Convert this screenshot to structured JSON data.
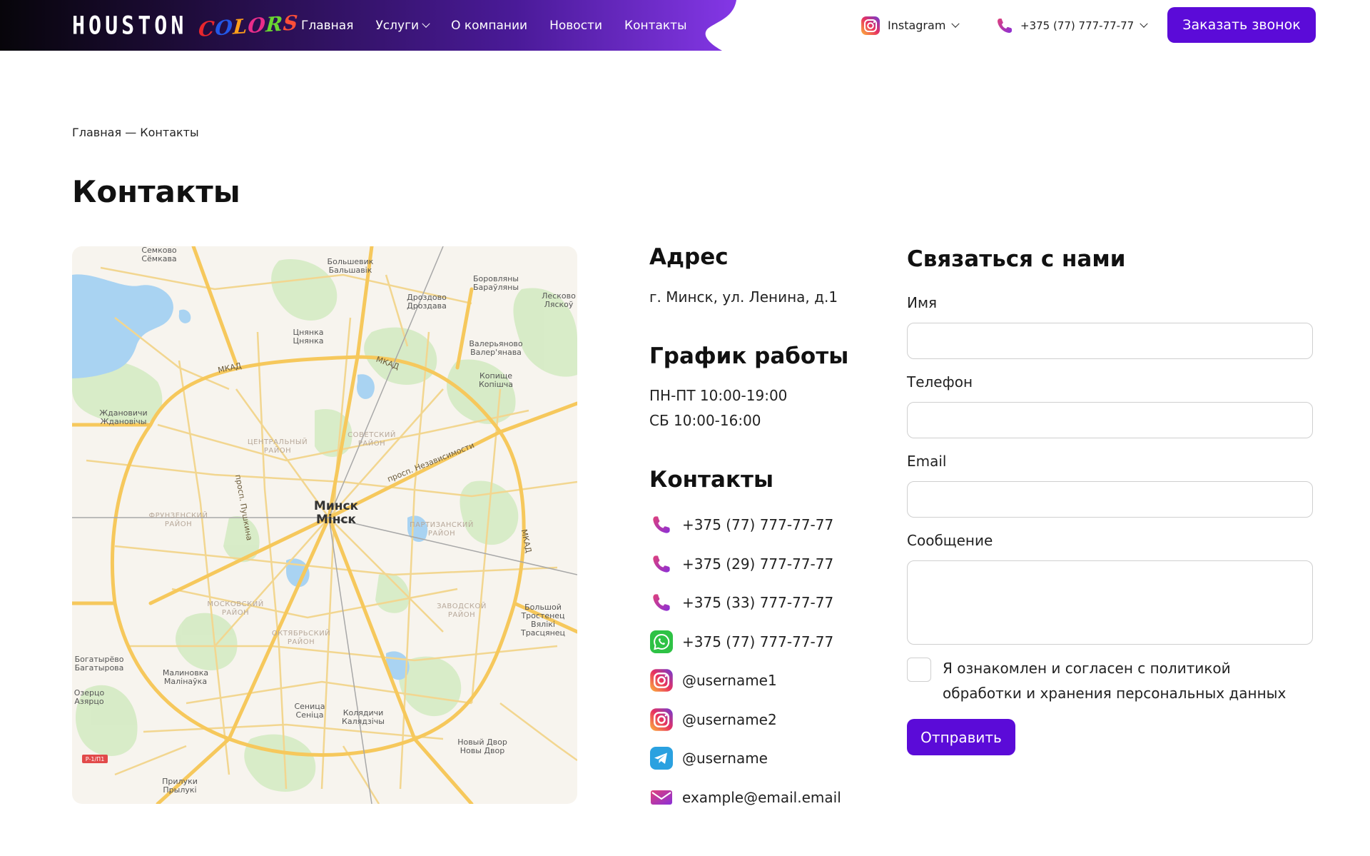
{
  "colors": {
    "accent": "#5b0bd8",
    "header_gradient_start": "#0a0612",
    "header_gradient_end": "#7a2fe0",
    "phone_icon": "#c83a8e",
    "whatsapp": "#2ec245",
    "telegram": "#2aa1e0"
  },
  "header": {
    "logo_main": "HOUSTON",
    "logo_accent": "COLORS",
    "nav": [
      {
        "label": "Главная"
      },
      {
        "label": "Услуги"
      },
      {
        "label": "О компании"
      },
      {
        "label": "Новости"
      },
      {
        "label": "Контакты"
      }
    ],
    "instagram_label": "Instagram",
    "phone_label": "+375 (77) 777-77-77",
    "callback_label": "Заказать звонок"
  },
  "breadcrumb": "Главная — Контакты",
  "page_title": "Контакты",
  "map": {
    "city": "Минск",
    "city_alt": "Мінск",
    "labels": [
      {
        "text": "Семково\nСёмкава"
      },
      {
        "text": "Большевик\nБальшавік"
      },
      {
        "text": "Боровляны\nБараўляны"
      },
      {
        "text": "Дроздово\nДроздава"
      },
      {
        "text": "Лесково\nЛяскоў"
      },
      {
        "text": "Цнянка\nЦнянка"
      },
      {
        "text": "Валерьяново\nВалер'янава"
      },
      {
        "text": "Копище\nКопішча"
      },
      {
        "text": "Ждановичи\nЖдановічы"
      },
      {
        "text": "Богатырёво\nБагатырова"
      },
      {
        "text": "Малиновка\nМалінаўка"
      },
      {
        "text": "Озерцо\nАзярцо"
      },
      {
        "text": "Сеница\nСеніца"
      },
      {
        "text": "Колядичи\nКалядзічы"
      },
      {
        "text": "Новый Двор\nНовы Двор"
      },
      {
        "text": "Большой\nТростенец\nВялікі\nТрасцянец"
      },
      {
        "text": "Прилуки\nПрылукі"
      }
    ],
    "districts": [
      {
        "text": "ЦЕНТРАЛЬНЫЙ\nРАЙОН"
      },
      {
        "text": "СОВЕТСКИЙ\nРАЙОН"
      },
      {
        "text": "ФРУНЗЕНСКИЙ\nРАЙОН"
      },
      {
        "text": "ПАРТИЗАНСКИЙ\nРАЙОН"
      },
      {
        "text": "МОСКОВСКИЙ\nРАЙОН"
      },
      {
        "text": "ЗАВОДСКОЙ\nРАЙОН"
      },
      {
        "text": "ОКТЯБРЬСКИЙ\nРАЙОН"
      }
    ],
    "roads": [
      {
        "text": "МКАД"
      },
      {
        "text": "МКАД"
      },
      {
        "text": "МКАД"
      },
      {
        "text": "просп. Независимости"
      },
      {
        "text": "просп. Пушкина"
      }
    ]
  },
  "address": {
    "heading": "Адрес",
    "text": "г. Минск, ул. Ленина, д.1"
  },
  "schedule": {
    "heading": "График работы",
    "lines": [
      "ПН-ПТ 10:00-19:00",
      "СБ 10:00-16:00"
    ]
  },
  "contacts": {
    "heading": "Контакты",
    "items": [
      {
        "icon": "phone-icon",
        "text": "+375 (77) 777-77-77"
      },
      {
        "icon": "phone-icon",
        "text": "+375 (29) 777-77-77"
      },
      {
        "icon": "phone-icon",
        "text": "+375 (33) 777-77-77"
      },
      {
        "icon": "whatsapp-icon",
        "text": "+375 (77) 777-77-77"
      },
      {
        "icon": "instagram-icon",
        "text": "@username1"
      },
      {
        "icon": "instagram-icon",
        "text": "@username2"
      },
      {
        "icon": "telegram-icon",
        "text": "@username"
      },
      {
        "icon": "mail-icon",
        "text": "example@email.email"
      }
    ]
  },
  "form": {
    "title": "Связаться с нами",
    "name_label": "Имя",
    "name_value": "",
    "phone_label": "Телефон",
    "phone_value": "",
    "email_label": "Email",
    "email_value": "",
    "message_label": "Сообщение",
    "message_value": "",
    "consent_text": "Я ознакомлен и согласен с политикой обработки и хранения персональных данных",
    "consent_checked": false,
    "submit_label": "Отправить"
  }
}
